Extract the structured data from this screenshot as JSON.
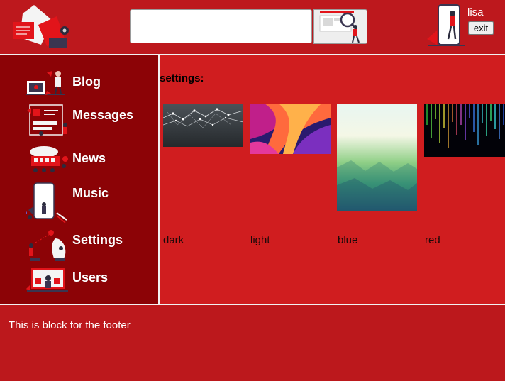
{
  "header": {
    "search": {
      "value": "",
      "placeholder": ""
    },
    "search_button_icon": "magnifier-illustration",
    "user": {
      "name": "lisa",
      "exit_label": "exit"
    }
  },
  "sidebar": {
    "items": [
      {
        "label": "Blog",
        "icon": "blog-illustration"
      },
      {
        "label": "Messages",
        "icon": "messages-illustration"
      },
      {
        "label": "News",
        "icon": "news-illustration"
      },
      {
        "label": "Music",
        "icon": "music-illustration"
      },
      {
        "label": "Settings",
        "icon": "settings-illustration"
      },
      {
        "label": "Users",
        "icon": "users-illustration"
      }
    ]
  },
  "main": {
    "title": "settings:",
    "themes": [
      {
        "label": "dark"
      },
      {
        "label": "light"
      },
      {
        "label": "blue"
      },
      {
        "label": "red"
      }
    ]
  },
  "footer": {
    "text": "This is block for the footer"
  },
  "colors": {
    "header_bg": "#bd181d",
    "sidebar_bg": "#8c0306",
    "main_bg": "#d01d1f",
    "footer_bg": "#bc181c",
    "divider": "#f2f2f2"
  }
}
